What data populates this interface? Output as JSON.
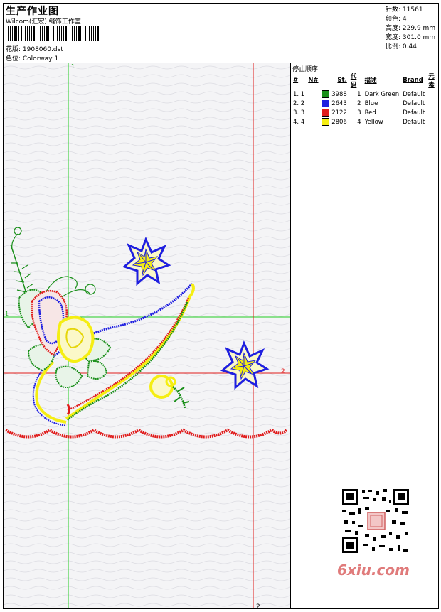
{
  "header": {
    "title": "生产作业图",
    "subtitle": "Wilcom(汇宏) 缝饰工作室",
    "design_label": "花版: 1908060.dst",
    "colorway_label": "色位: Colorway 1"
  },
  "stats": [
    {
      "label": "针数",
      "value": "11561"
    },
    {
      "label": "颜色",
      "value": "4"
    },
    {
      "label": "高度",
      "value": "229.9 mm"
    },
    {
      "label": "宽度",
      "value": "301.0 mm"
    },
    {
      "label": "比例",
      "value": "0.44"
    }
  ],
  "stop_sequence": {
    "title": "停止顺序:",
    "columns": [
      "#",
      "N#",
      "St.",
      "代码",
      "描述",
      "Brand",
      "元素"
    ],
    "rows": [
      {
        "idx": "1. 1",
        "swatch": "#1a8f1a",
        "st": "3988",
        "code": "1",
        "desc": "Dark Green",
        "brand": "Default"
      },
      {
        "idx": "2. 2",
        "swatch": "#1f1fe0",
        "st": "2643",
        "code": "2",
        "desc": "Blue",
        "brand": "Default"
      },
      {
        "idx": "3. 3",
        "swatch": "#e01b1b",
        "st": "2122",
        "code": "3",
        "desc": "Red",
        "brand": "Default"
      },
      {
        "idx": "4. 4",
        "swatch": "#f5ee12",
        "st": "2806",
        "code": "4",
        "desc": "Yellow",
        "brand": "Default"
      }
    ]
  },
  "guides": {
    "v1": "1",
    "h1": "1",
    "v2": "2",
    "h2": "2"
  },
  "watermark": {
    "text": "6xiu.com"
  },
  "colors": {
    "green_guide": "#22cc22",
    "red_guide": "#e01b1b",
    "frame": "#000000"
  }
}
